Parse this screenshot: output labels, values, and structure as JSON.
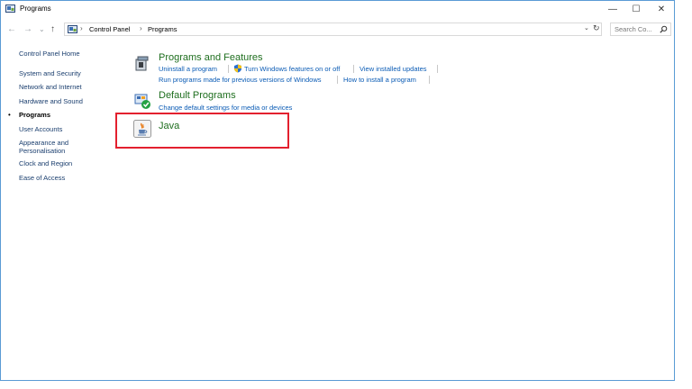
{
  "window": {
    "title": "Programs"
  },
  "controls": {
    "minimize": "—",
    "maximize": "☐",
    "close": "✕"
  },
  "address": {
    "back": "←",
    "forward": "→",
    "recent": "⌄",
    "up": "↑",
    "crumbs": [
      "Control Panel",
      "Programs"
    ],
    "separator": "›",
    "dropdown": "⌄",
    "refresh": "↻"
  },
  "search": {
    "placeholder": "Search Co..."
  },
  "sidebar": {
    "bullet": "•",
    "items": [
      {
        "label": "Control Panel Home"
      },
      {
        "label": "System and Security"
      },
      {
        "label": "Network and Internet"
      },
      {
        "label": "Hardware and Sound"
      },
      {
        "label": "Programs"
      },
      {
        "label": "User Accounts"
      },
      {
        "label": "Appearance and Personalisation"
      },
      {
        "label": "Clock and Region"
      },
      {
        "label": "Ease of Access"
      }
    ]
  },
  "sections": {
    "programs_features": {
      "title": "Programs and Features",
      "links": [
        "Uninstall a program",
        "Turn Windows features on or off",
        "View installed updates",
        "Run programs made for previous versions of Windows",
        "How to install a program"
      ]
    },
    "default_programs": {
      "title": "Default Programs",
      "links": [
        "Change default settings for media or devices"
      ]
    },
    "java": {
      "title": "Java"
    }
  }
}
